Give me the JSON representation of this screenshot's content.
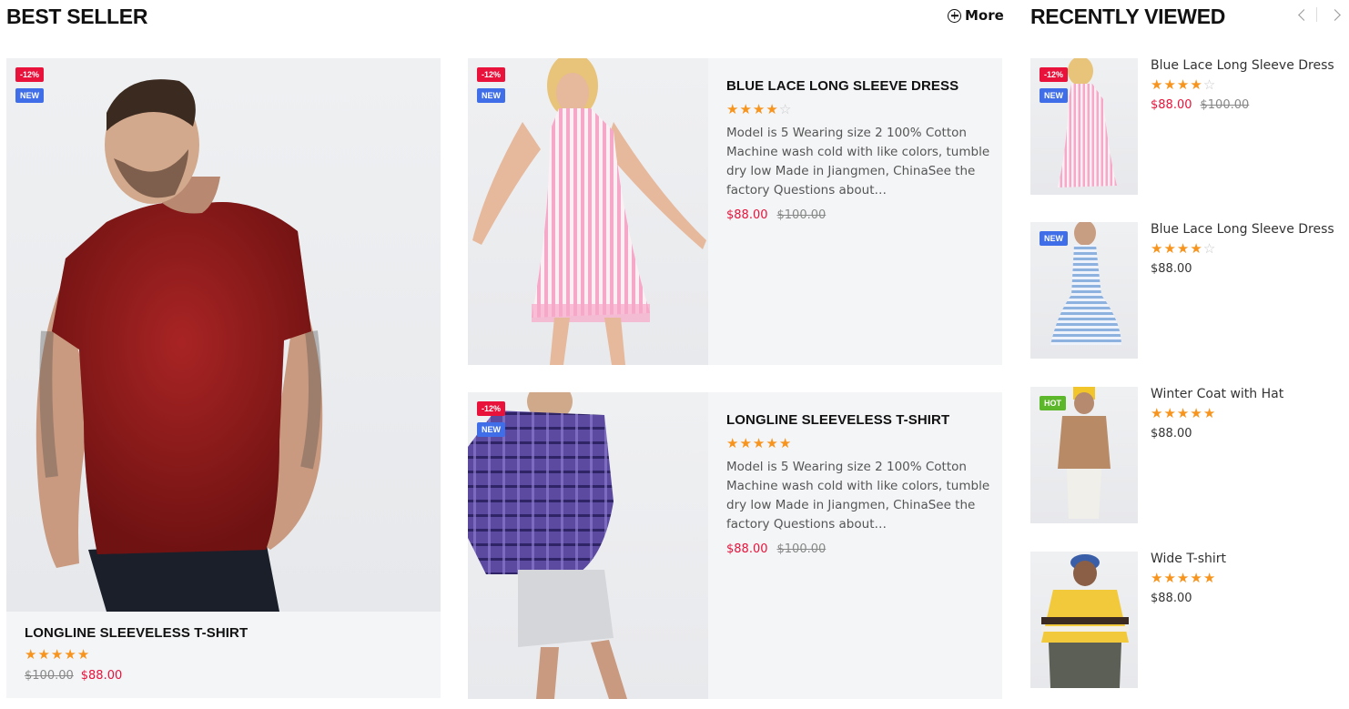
{
  "best_seller": {
    "title": "BEST SELLER",
    "more_label": "More",
    "featured": {
      "name": "LONGLINE SLEEVELESS T-SHIRT",
      "badges": [
        "-12%",
        "NEW"
      ],
      "rating": 5,
      "old_price": "$100.00",
      "price": "$88.00"
    },
    "cards": [
      {
        "name": "BLUE LACE LONG SLEEVE DRESS",
        "badges": [
          "-12%",
          "NEW"
        ],
        "rating": 4,
        "description": "Model is 5 Wearing size 2 100% Cotton Machine wash cold with like colors, tumble dry low Made in Jiangmen, ChinaSee the factory Questions about…",
        "price": "$88.00",
        "old_price": "$100.00"
      },
      {
        "name": "LONGLINE SLEEVELESS T-SHIRT",
        "badges": [
          "-12%",
          "NEW"
        ],
        "rating": 5,
        "description": "Model is 5 Wearing size 2 100% Cotton Machine wash cold with like colors, tumble dry low Made in Jiangmen, ChinaSee the factory Questions about…",
        "price": "$88.00",
        "old_price": "$100.00"
      }
    ]
  },
  "recently_viewed": {
    "title": "RECENTLY VIEWED",
    "items": [
      {
        "name": "Blue Lace Long Sleeve Dress",
        "badges": [
          "-12%",
          "NEW"
        ],
        "rating": 4,
        "price": "$88.00",
        "old_price": "$100.00"
      },
      {
        "name": "Blue Lace Long Sleeve Dress",
        "badges": [
          "NEW"
        ],
        "rating": 4,
        "price": "$88.00"
      },
      {
        "name": "Winter Coat with Hat",
        "badges": [
          "HOT"
        ],
        "rating": 5,
        "price": "$88.00"
      },
      {
        "name": "Wide T-shirt",
        "badges": [],
        "rating": 5,
        "price": "$88.00"
      }
    ]
  },
  "colors": {
    "sale_badge": "#e8123b",
    "new_badge": "#3f6ee8",
    "hot_badge": "#5cb82a",
    "star": "#f7941d",
    "price_red": "#e8123b"
  }
}
